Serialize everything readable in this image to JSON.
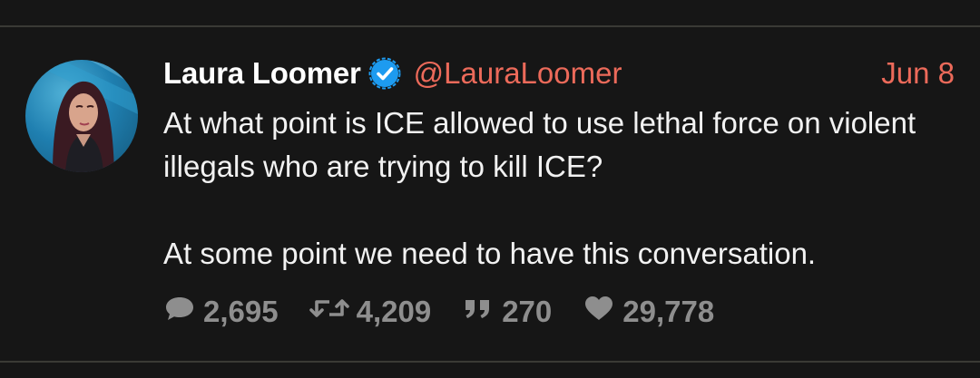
{
  "tweet": {
    "display_name": "Laura Loomer",
    "verified_icon": "verified-badge-icon",
    "handle": "@LauraLoomer",
    "date": "Jun 8",
    "text_paragraphs": [
      "At what point is ICE allowed to use lethal force on violent illegals who are trying to kill ICE?",
      "At some point we need to have this conversation."
    ],
    "stats": {
      "replies": "2,695",
      "retweets": "4,209",
      "quotes": "270",
      "likes": "29,778"
    }
  },
  "colors": {
    "background": "#161616",
    "accent": "#ec6a5a",
    "verified": "#1d9bf0",
    "muted": "#8e8e8e"
  }
}
